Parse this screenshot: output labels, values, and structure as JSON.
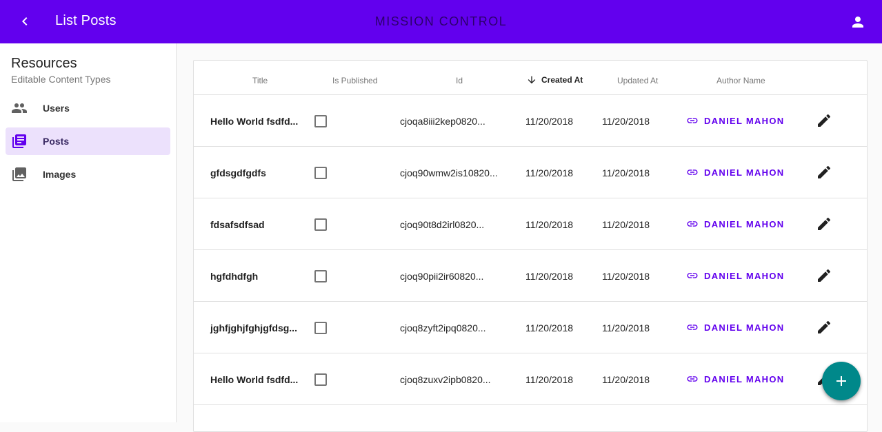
{
  "appbar": {
    "page_title": "List Posts",
    "brand": "MISSION CONTROL",
    "color": "#6200ee"
  },
  "sidebar": {
    "title": "Resources",
    "subtitle": "Editable Content Types",
    "items": [
      {
        "label": "Users",
        "icon": "people-icon",
        "active": false
      },
      {
        "label": "Posts",
        "icon": "library-books-icon",
        "active": true
      },
      {
        "label": "Images",
        "icon": "photo-library-icon",
        "active": false
      }
    ]
  },
  "table": {
    "columns": [
      "Title",
      "Is Published",
      "Id",
      "Created At",
      "Updated At",
      "Author Name"
    ],
    "sorted_column": "Created At",
    "sort_direction": "descending",
    "rows": [
      {
        "title": "Hello World fsdfd...",
        "published": false,
        "id": "cjoqa8iii2kep0820...",
        "created": "11/20/2018",
        "updated": "11/20/2018",
        "author": "DANIEL MAHON"
      },
      {
        "title": "gfdsgdfgdfs",
        "published": false,
        "id": "cjoq90wmw2is10820...",
        "created": "11/20/2018",
        "updated": "11/20/2018",
        "author": "DANIEL MAHON"
      },
      {
        "title": "fdsafsdfsad",
        "published": false,
        "id": "cjoq90t8d2irl0820...",
        "created": "11/20/2018",
        "updated": "11/20/2018",
        "author": "DANIEL MAHON"
      },
      {
        "title": "hgfdhdfgh",
        "published": false,
        "id": "cjoq90pii2ir60820...",
        "created": "11/20/2018",
        "updated": "11/20/2018",
        "author": "DANIEL MAHON"
      },
      {
        "title": "jghfjghjfghjgfdsg...",
        "published": false,
        "id": "cjoq8zyft2ipq0820...",
        "created": "11/20/2018",
        "updated": "11/20/2018",
        "author": "DANIEL MAHON"
      },
      {
        "title": "Hello World fsdfd...",
        "published": false,
        "id": "cjoq8zuxv2ipb0820...",
        "created": "11/20/2018",
        "updated": "11/20/2018",
        "author": "DANIEL MAHON"
      }
    ]
  },
  "fab": {
    "icon": "add-icon",
    "color": "#00888a"
  }
}
